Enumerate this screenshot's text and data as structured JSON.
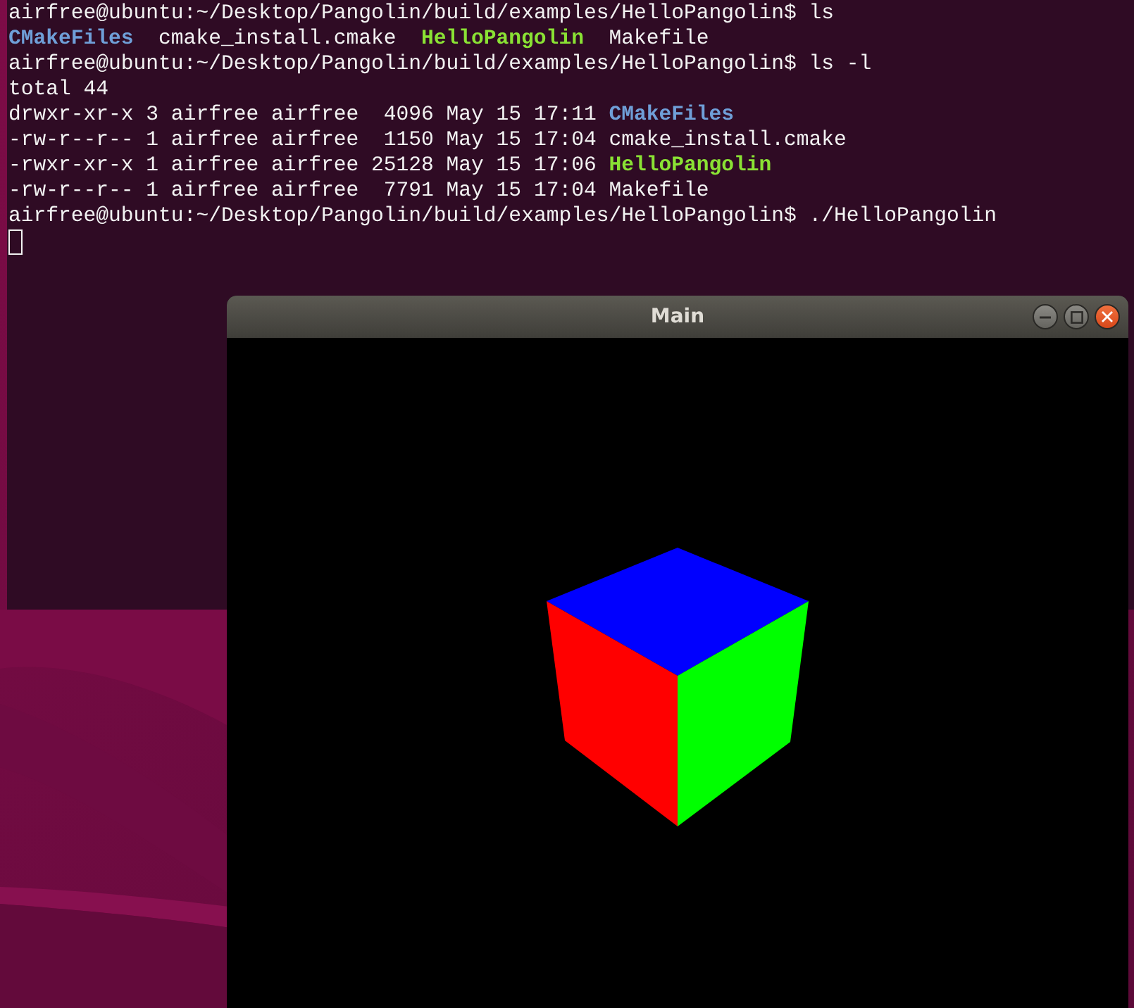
{
  "terminal": {
    "lines": [
      {
        "kind": "text",
        "segments": [
          {
            "kind": "plain",
            "text": "airfree@ubuntu:~/Desktop/Pangolin/build/examples/HelloPangolin$ ls"
          }
        ]
      },
      {
        "kind": "columns",
        "segments": [
          {
            "kind": "directory",
            "text": "CMakeFiles"
          },
          {
            "kind": "plain",
            "text": "cmake_install.cmake"
          },
          {
            "kind": "executable",
            "text": "HelloPangolin"
          },
          {
            "kind": "plain",
            "text": "Makefile"
          }
        ]
      },
      {
        "kind": "text",
        "segments": [
          {
            "kind": "plain",
            "text": "airfree@ubuntu:~/Desktop/Pangolin/build/examples/HelloPangolin$ ls -l"
          }
        ]
      },
      {
        "kind": "text",
        "segments": [
          {
            "kind": "plain",
            "text": "total 44"
          }
        ]
      },
      {
        "kind": "text",
        "segments": [
          {
            "kind": "plain",
            "text": "drwxr-xr-x 3 airfree airfree  4096 May 15 17:11"
          },
          {
            "kind": "directory",
            "text": "CMakeFiles"
          }
        ]
      },
      {
        "kind": "text",
        "segments": [
          {
            "kind": "plain",
            "text": "-rw-r--r-- 1 airfree airfree  1150 May 15 17:04"
          },
          {
            "kind": "plain",
            "text": "cmake_install.cmake"
          }
        ]
      },
      {
        "kind": "text",
        "segments": [
          {
            "kind": "plain",
            "text": "-rwxr-xr-x 1 airfree airfree 25128 May 15 17:06"
          },
          {
            "kind": "executable",
            "text": "HelloPangolin"
          }
        ]
      },
      {
        "kind": "text",
        "segments": [
          {
            "kind": "plain",
            "text": "-rw-r--r-- 1 airfree airfree  7791 May 15 17:04"
          },
          {
            "kind": "plain",
            "text": "Makefile"
          }
        ]
      },
      {
        "kind": "text",
        "segments": [
          {
            "kind": "plain",
            "text": "airfree@ubuntu:~/Desktop/Pangolin/build/examples/HelloPangolin$ ./HelloPangolin"
          }
        ]
      }
    ]
  },
  "window": {
    "title": "Main"
  }
}
